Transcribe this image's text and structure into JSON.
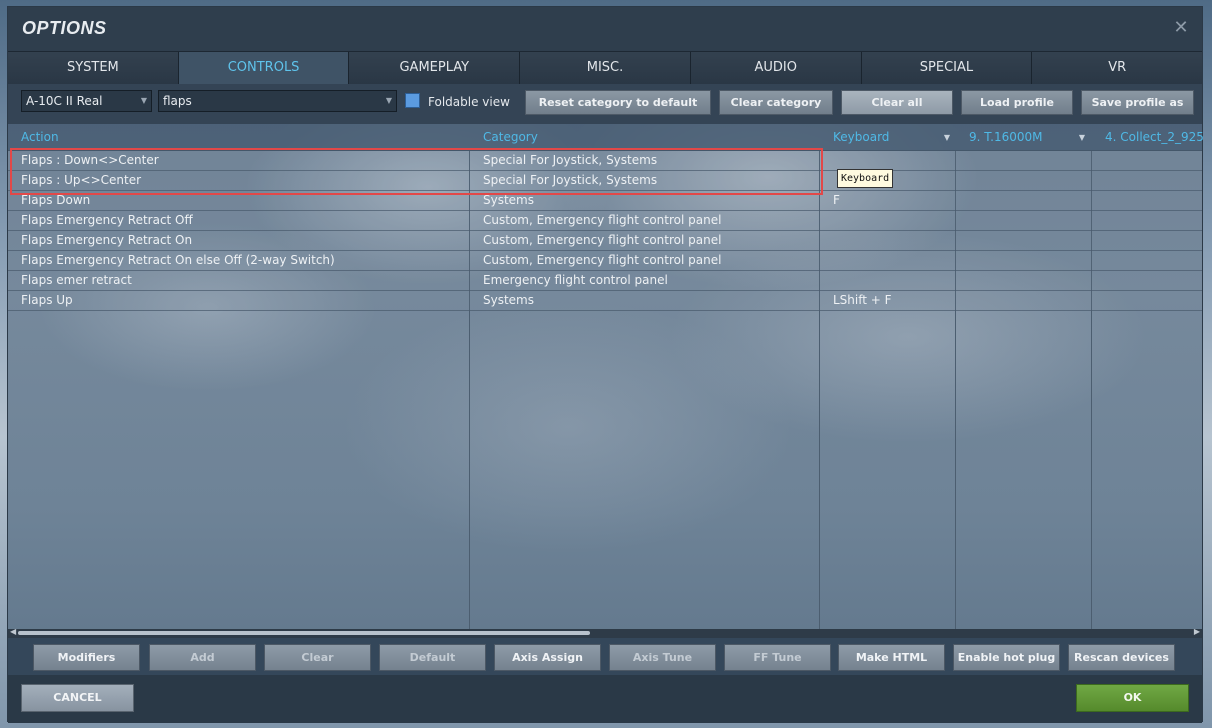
{
  "window": {
    "title": "OPTIONS",
    "close_glyph": "✕"
  },
  "tabs": [
    {
      "label": "SYSTEM"
    },
    {
      "label": "CONTROLS"
    },
    {
      "label": "GAMEPLAY"
    },
    {
      "label": "MISC."
    },
    {
      "label": "AUDIO"
    },
    {
      "label": "SPECIAL"
    },
    {
      "label": "VR"
    }
  ],
  "active_tab": "CONTROLS",
  "toolbar": {
    "aircraft_select": "A-10C II Real",
    "category_filter": "flaps",
    "foldable_view_label": "Foldable view",
    "foldable_view_checked": true,
    "reset_category_label": "Reset category to default",
    "clear_category_label": "Clear category",
    "clear_all_label": "Clear all",
    "load_profile_label": "Load profile",
    "save_profile_label": "Save profile as"
  },
  "table": {
    "headers": {
      "action": "Action",
      "category": "Category",
      "keyboard": "Keyboard",
      "device1": "9. T.16000M",
      "device2": "4. Collect_2_925..."
    },
    "rows": [
      {
        "action": "Flaps : Down<>Center",
        "category": "Special For Joystick, Systems",
        "keyboard": ""
      },
      {
        "action": "Flaps : Up<>Center",
        "category": "Special For Joystick, Systems",
        "keyboard": ""
      },
      {
        "action": "Flaps Down",
        "category": "Systems",
        "keyboard": "F"
      },
      {
        "action": "Flaps Emergency Retract Off",
        "category": "Custom, Emergency flight control panel",
        "keyboard": ""
      },
      {
        "action": "Flaps Emergency Retract On",
        "category": "Custom, Emergency flight control panel",
        "keyboard": ""
      },
      {
        "action": "Flaps Emergency Retract On else Off (2-way Switch)",
        "category": "Custom, Emergency flight control panel",
        "keyboard": ""
      },
      {
        "action": "Flaps emer retract",
        "category": "Emergency flight control panel",
        "keyboard": ""
      },
      {
        "action": "Flaps Up",
        "category": "Systems",
        "keyboard": "LShift + F"
      }
    ]
  },
  "tooltip": "Keyboard",
  "bottom_buttons": {
    "modifiers": "Modifiers",
    "add": "Add",
    "clear": "Clear",
    "default": "Default",
    "axis_assign": "Axis Assign",
    "axis_tune": "Axis Tune",
    "ff_tune": "FF Tune",
    "make_html": "Make HTML",
    "enable_hot_plug": "Enable hot plug",
    "rescan_devices": "Rescan devices"
  },
  "footer": {
    "cancel_label": "CANCEL",
    "ok_label": "OK"
  },
  "colors": {
    "accent": "#5fc4ec",
    "ok": "#5e9636",
    "highlight": "#e24848"
  }
}
